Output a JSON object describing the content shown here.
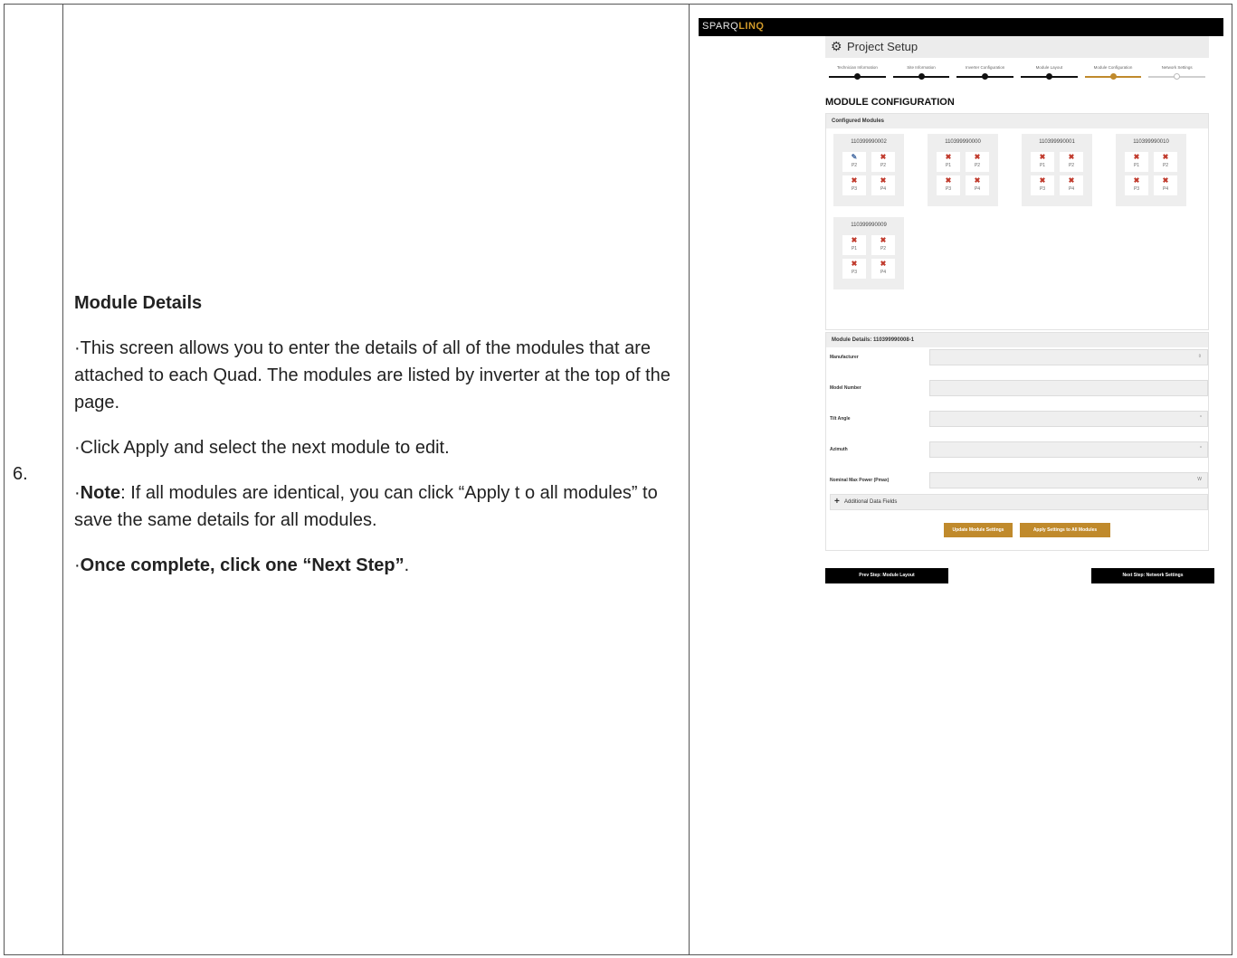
{
  "step_number": "6.",
  "description": {
    "title": "Module Details",
    "para1": "·This screen allows you to enter the details of all of the modules that are attached to each Quad. The modules are listed by inverter at the top of the page.",
    "para2": "·Click Apply and select the next module to edit.",
    "para3_prefix": "·",
    "para3_bold": "Note",
    "para3_rest": ": If all modules are identical, you can click “Apply t o all modules” to save the same details for all modules.",
    "para4_prefix": "·",
    "para4_bold": "Once complete, click one “Next Step”",
    "para4_suffix": "."
  },
  "app": {
    "brand_part1": "SPARQ",
    "brand_part2": "LINQ",
    "setup_title": "Project Setup",
    "steps": [
      {
        "label": "Technician Information",
        "state": "done"
      },
      {
        "label": "Site Information",
        "state": "done"
      },
      {
        "label": "Inverter Configuration",
        "state": "done"
      },
      {
        "label": "Module Layout",
        "state": "done"
      },
      {
        "label": "Module Configuration",
        "state": "active"
      },
      {
        "label": "Network Settings",
        "state": "pending"
      }
    ],
    "section_title": "MODULE CONFIGURATION",
    "configured_header": "Configured Modules",
    "inverters": [
      {
        "id": "110399990002",
        "modules": [
          [
            "P2",
            "edit"
          ],
          [
            "P2",
            "x"
          ],
          [
            "P3",
            "x"
          ],
          [
            "P4",
            "x"
          ]
        ]
      },
      {
        "id": "110399990000",
        "modules": [
          [
            "P1",
            "x"
          ],
          [
            "P2",
            "x"
          ],
          [
            "P3",
            "x"
          ],
          [
            "P4",
            "x"
          ]
        ]
      },
      {
        "id": "110399990001",
        "modules": [
          [
            "P1",
            "x"
          ],
          [
            "P2",
            "x"
          ],
          [
            "P3",
            "x"
          ],
          [
            "P4",
            "x"
          ]
        ]
      },
      {
        "id": "110399990010",
        "modules": [
          [
            "P1",
            "x"
          ],
          [
            "P2",
            "x"
          ],
          [
            "P3",
            "x"
          ],
          [
            "P4",
            "x"
          ]
        ]
      },
      {
        "id": "110399990009",
        "modules": [
          [
            "P1",
            "x"
          ],
          [
            "P2",
            "x"
          ],
          [
            "P3",
            "x"
          ],
          [
            "P4",
            "x"
          ]
        ]
      }
    ],
    "details_header": "Module Details: 110399990008-1",
    "fields": [
      {
        "label": "Manufacturer",
        "suffix": "⇳"
      },
      {
        "label": "Model Number",
        "suffix": ""
      },
      {
        "label": "Tilt Angle",
        "suffix": "°"
      },
      {
        "label": "Azimuth",
        "suffix": "°"
      },
      {
        "label": "Nominal Max Power (Pmax)",
        "suffix": "W"
      }
    ],
    "additional_fields": "Additional Data Fields",
    "update_button": "Update Module Settings",
    "apply_all_button": "Apply Settings to All Modules",
    "prev_button": "Prev Step: Module Layout",
    "next_button": "Next Step: Network Settings",
    "colors": {
      "accent": "#c08a2c",
      "header_bg": "#000000",
      "error_x": "#c0392b"
    }
  }
}
